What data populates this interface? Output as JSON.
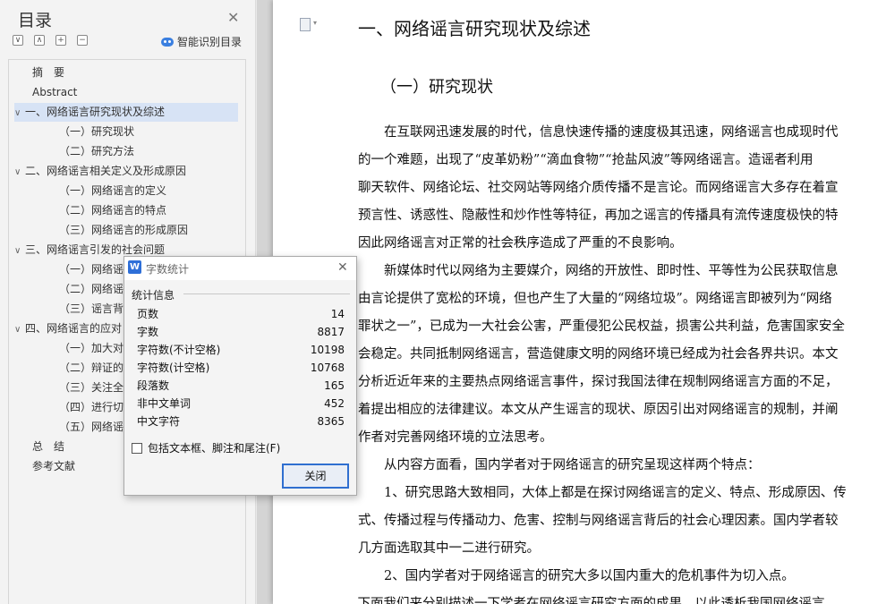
{
  "sidebar": {
    "title": "目录",
    "smart_label": "智能识别目录",
    "tools": [
      "expand-all",
      "collapse-all",
      "add-level",
      "remove-level"
    ],
    "items": [
      {
        "label": "摘　要",
        "level": 0,
        "chev": ""
      },
      {
        "label": "Abstract",
        "level": 0,
        "chev": ""
      },
      {
        "label": "一、网络谣言研究现状及综述",
        "level": 0,
        "chev": "∨",
        "selected": true
      },
      {
        "label": "（一）研究现状",
        "level": 1,
        "chev": ""
      },
      {
        "label": "（二）研究方法",
        "level": 1,
        "chev": ""
      },
      {
        "label": "二、网络谣言相关定义及形成原因",
        "level": 0,
        "chev": "∨"
      },
      {
        "label": "（一）网络谣言的定义",
        "level": 1,
        "chev": ""
      },
      {
        "label": "（二）网络谣言的特点",
        "level": 1,
        "chev": ""
      },
      {
        "label": "（三）网络谣言的形成原因",
        "level": 1,
        "chev": ""
      },
      {
        "label": "三、网络谣言引发的社会问题",
        "level": 0,
        "chev": "∨"
      },
      {
        "label": "（一）网络谣",
        "level": 1,
        "chev": ""
      },
      {
        "label": "（二）网络谣",
        "level": 1,
        "chev": ""
      },
      {
        "label": "（三）谣言背",
        "level": 1,
        "chev": ""
      },
      {
        "label": "四、网络谣言的应对",
        "level": 0,
        "chev": "∨"
      },
      {
        "label": "（一）加大对",
        "level": 1,
        "chev": ""
      },
      {
        "label": "（二）辩证的",
        "level": 1,
        "chev": ""
      },
      {
        "label": "（三）关注全",
        "level": 1,
        "chev": ""
      },
      {
        "label": "（四）进行切",
        "level": 1,
        "chev": ""
      },
      {
        "label": "（五）网络谣",
        "level": 1,
        "chev": ""
      },
      {
        "label": "总　结",
        "level": 0,
        "chev": ""
      },
      {
        "label": "参考文献",
        "level": 0,
        "chev": ""
      }
    ]
  },
  "document": {
    "h1": "一、网络谣言研究现状及综述",
    "h2": "（一）研究现状",
    "lines": [
      "　　在互联网迅速发展的时代，信息快速传播的速度极其迅速，网络谣言也成现时代",
      "的一个难题，出现了“皮革奶粉”“滴血食物”“抢盐风波”等网络谣言。造谣者利用",
      "聊天软件、网络论坛、社交网站等网络介质传播不是言论。而网络谣言大多存在着宣",
      "预言性、诱惑性、隐蔽性和炒作性等特征，再加之谣言的传播具有流传速度极快的特",
      "因此网络谣言对正常的社会秩序造成了严重的不良影响。",
      "　　新媒体时代以网络为主要媒介，网络的开放性、即时性、平等性为公民获取信息",
      "由言论提供了宽松的环境，但也产生了大量的“网络垃圾”。网络谣言即被列为“网络",
      "罪状之一”，已成为一大社会公害，严重侵犯公民权益，损害公共利益，危害国家安全",
      "会稳定。共同抵制网络谣言，营造健康文明的网络环境已经成为社会各界共识。本文",
      "分析近近年来的主要热点网络谣言事件，探讨我国法律在规制网络谣言方面的不足，",
      "着提出相应的法律建议。本文从产生谣言的现状、原因引出对网络谣言的规制，并阐",
      "作者对完善网络环境的立法思考。",
      "　　从内容方面看，国内学者对于网络谣言的研究呈现这样两个特点：",
      "　　1、研究思路大致相同，大体上都是在探讨网络谣言的定义、特点、形成原因、传",
      "式、传播过程与传播动力、危害、控制与网络谣言背后的社会心理因素。国内学者较",
      "几方面选取其中一二进行研究。",
      "　　2、国内学者对于网络谣言的研究大多以国内重大的危机事件为切入点。",
      "　下面我们来分别描述一下学者在网络谣言研究方面的成果，以此透析我国网络谣言"
    ]
  },
  "dialog": {
    "title": "字数统计",
    "group_label": "统计信息",
    "stats": [
      {
        "label": "页数",
        "value": "14"
      },
      {
        "label": "字数",
        "value": "8817"
      },
      {
        "label": "字符数(不计空格)",
        "value": "10198"
      },
      {
        "label": "字符数(计空格)",
        "value": "10768"
      },
      {
        "label": "段落数",
        "value": "165"
      },
      {
        "label": "非中文单词",
        "value": "452"
      },
      {
        "label": "中文字符",
        "value": "8365"
      }
    ],
    "checkbox_label": "包括文本框、脚注和尾注(F)",
    "close_label": "关闭"
  }
}
